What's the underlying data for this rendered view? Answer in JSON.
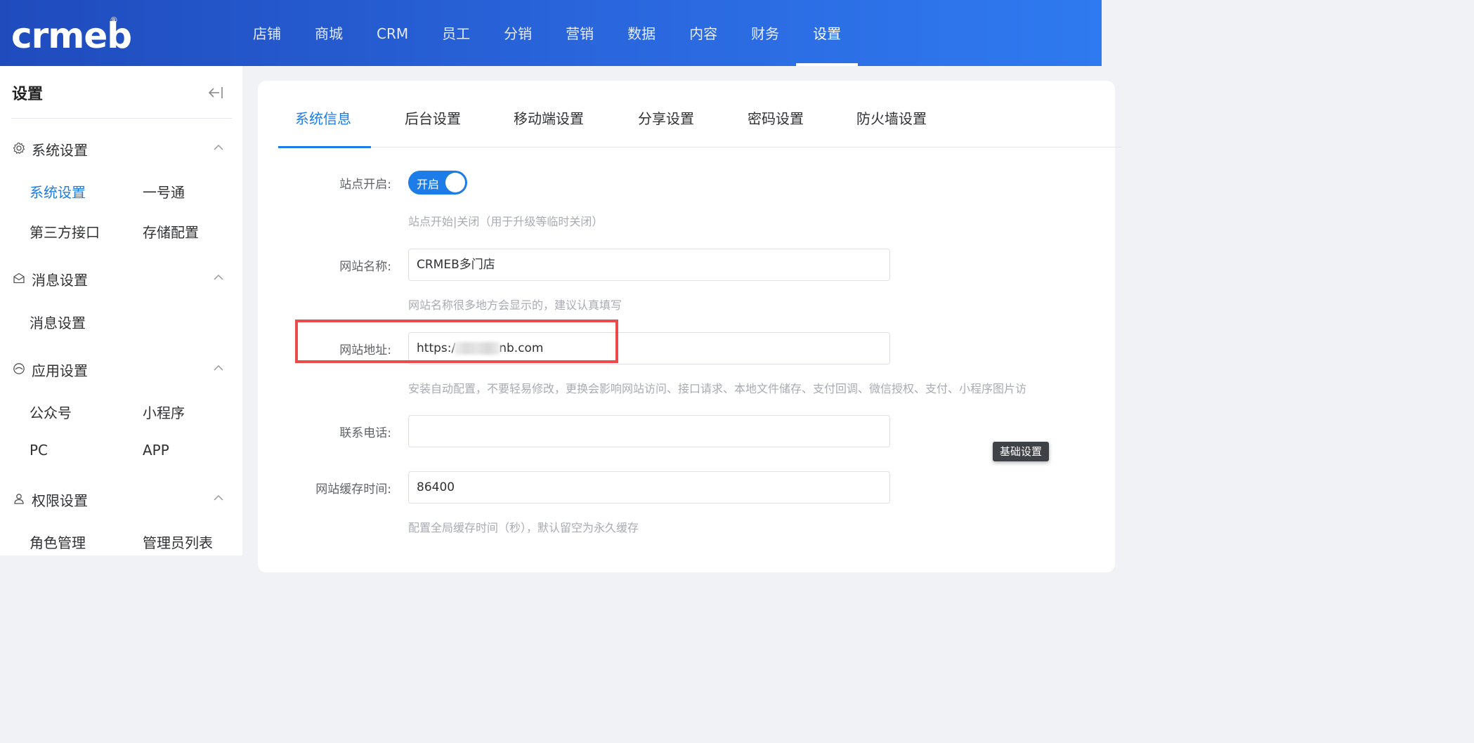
{
  "header": {
    "logo_text": "crmeb",
    "logo_reg": "®",
    "nav": [
      "店铺",
      "商城",
      "CRM",
      "员工",
      "分销",
      "营销",
      "数据",
      "内容",
      "财务",
      "设置"
    ],
    "active_nav": "设置"
  },
  "sidebar": {
    "title": "设置",
    "groups": [
      {
        "label": "系统设置",
        "icon": "gear-icon",
        "items": [
          "系统设置",
          "一号通",
          "第三方接口",
          "存储配置"
        ]
      },
      {
        "label": "消息设置",
        "icon": "envelope-icon",
        "items": [
          "消息设置"
        ]
      },
      {
        "label": "应用设置",
        "icon": "app-icon",
        "items": [
          "公众号",
          "小程序",
          "PC",
          "APP"
        ]
      },
      {
        "label": "权限设置",
        "icon": "user-icon",
        "items": [
          "角色管理",
          "管理员列表"
        ]
      }
    ],
    "active_item": "系统设置"
  },
  "tabs": [
    "系统信息",
    "后台设置",
    "移动端设置",
    "分享设置",
    "密码设置",
    "防火墙设置"
  ],
  "active_tab": "系统信息",
  "form": {
    "site_open": {
      "label": "站点开启:",
      "toggle_text": "开启",
      "hint": "站点开始|关闭（用于升级等临时关闭）"
    },
    "site_name": {
      "label": "网站名称:",
      "value": "CRMEB多门店",
      "hint": "网站名称很多地方会显示的，建议认真填写"
    },
    "site_url": {
      "label": "网站地址:",
      "value_prefix": "https:/",
      "value_suffix": "nb.com",
      "hint": "安装自动配置，不要轻易修改，更换会影响网站访问、接口请求、本地文件储存、支付回调、微信授权、支付、小程序图片访"
    },
    "phone": {
      "label": "联系电话:",
      "value": ""
    },
    "cache_time": {
      "label": "网站缓存时间:",
      "value": "86400",
      "hint": "配置全局缓存时间（秒），默认留空为永久缓存"
    }
  },
  "tooltip": "基础设置",
  "colors": {
    "primary": "#1e7ce8",
    "highlight": "#ec4b4b",
    "header_start": "#1f4bbd",
    "header_end": "#2f7af0"
  }
}
